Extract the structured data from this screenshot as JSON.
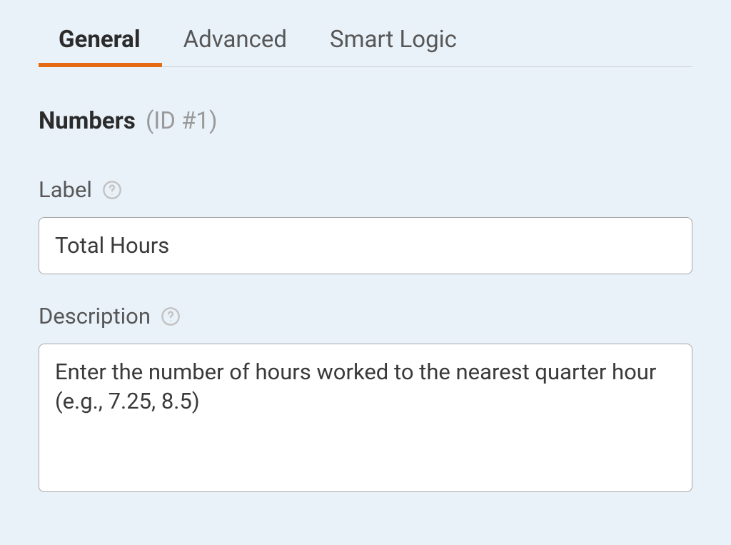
{
  "tabs": {
    "general": "General",
    "advanced": "Advanced",
    "smart_logic": "Smart Logic"
  },
  "section": {
    "title": "Numbers",
    "id_label": "(ID #1)"
  },
  "fields": {
    "label": {
      "label_text": "Label",
      "value": "Total Hours"
    },
    "description": {
      "label_text": "Description",
      "value": "Enter the number of hours worked to the nearest quarter hour (e.g., 7.25, 8.5)"
    }
  }
}
